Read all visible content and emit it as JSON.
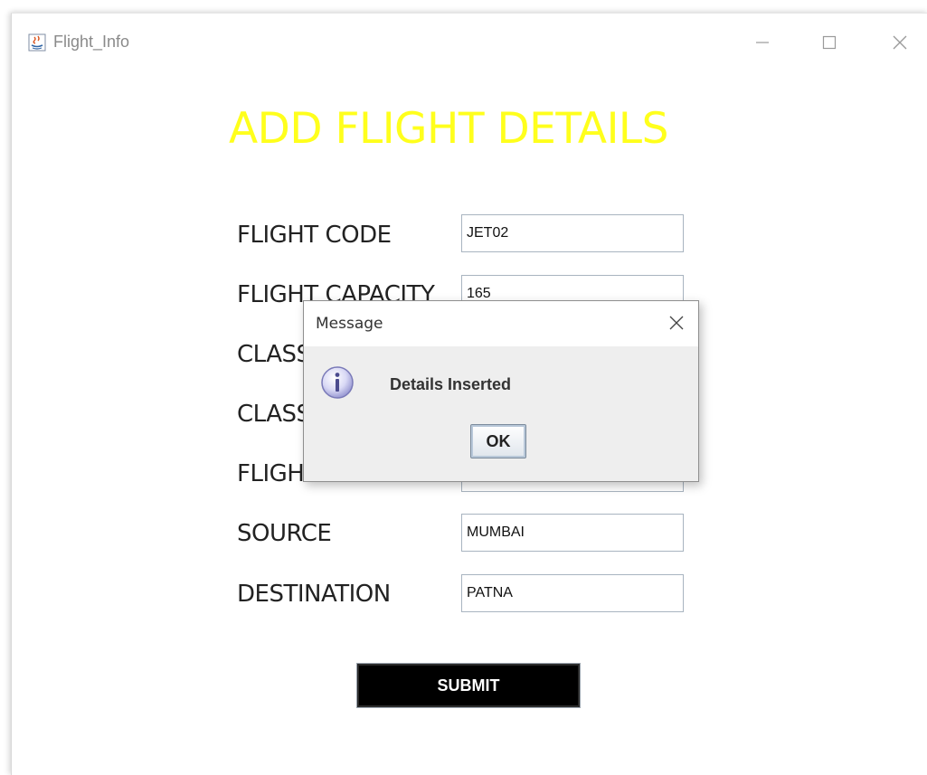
{
  "window": {
    "title": "Flight_Info",
    "icon": "java-app-icon",
    "controls": [
      "minimize-icon",
      "maximize-icon",
      "close-icon"
    ]
  },
  "heading": "ADD FLIGHT DETAILS",
  "form": {
    "fields": [
      {
        "label": "FLIGHT CODE",
        "value": "JET02"
      },
      {
        "label": "FLIGHT CAPACITY",
        "value": "165"
      },
      {
        "label": "CLASS",
        "value": ""
      },
      {
        "label": "CLASS",
        "value": ""
      },
      {
        "label": "FLIGHT",
        "value": ""
      },
      {
        "label": "SOURCE",
        "value": "MUMBAI"
      },
      {
        "label": "DESTINATION",
        "value": "PATNA"
      }
    ],
    "submit_label": "SUBMIT"
  },
  "dialog": {
    "title": "Message",
    "message": "Details Inserted",
    "ok_label": "OK",
    "icon": "info-icon"
  },
  "colors": {
    "heading": "#ffff1c",
    "submit_bg": "#000000",
    "dialog_bg": "#eeeeee"
  }
}
